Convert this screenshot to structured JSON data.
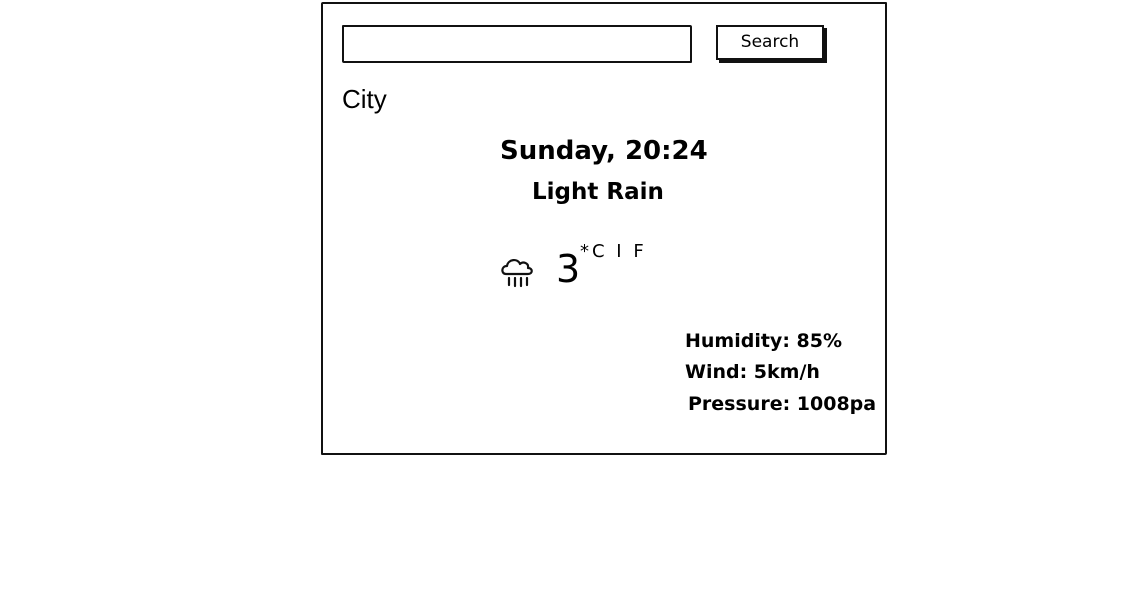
{
  "search": {
    "value": "",
    "placeholder": "",
    "button_label": "Search"
  },
  "location": {
    "city": "City"
  },
  "current": {
    "datetime": "Sunday, 20:24",
    "condition": "Light Rain",
    "icon": "rain-cloud-icon",
    "temperature": "3",
    "unit_toggle": "*C I F"
  },
  "details": {
    "humidity": "Humidity: 85%",
    "wind": "Wind: 5km/h",
    "pressure": "Pressure: 1008pa"
  }
}
